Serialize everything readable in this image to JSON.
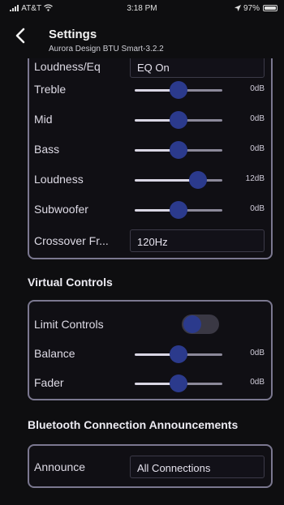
{
  "status_bar": {
    "carrier": "AT&T",
    "time": "3:18 PM",
    "battery": "97%",
    "battery_level": 0.97
  },
  "nav": {
    "title": "Settings",
    "subtitle": "Aurora Design BTU Smart-3.2.2"
  },
  "eq_section": {
    "partial_row": {
      "label": "Loudness/Eq",
      "value": "EQ On"
    },
    "sliders": [
      {
        "label": "Treble",
        "value": "0dB",
        "level": 0.5
      },
      {
        "label": "Mid",
        "value": "0dB",
        "level": 0.5
      },
      {
        "label": "Bass",
        "value": "0dB",
        "level": 0.5
      },
      {
        "label": "Loudness",
        "value": "12dB",
        "level": 0.72
      },
      {
        "label": "Subwoofer",
        "value": "0dB",
        "level": 0.5
      }
    ],
    "crossover": {
      "label": "Crossover Fr...",
      "value": "120Hz"
    }
  },
  "virtual_controls": {
    "header": "Virtual Controls",
    "limit_controls": {
      "label": "Limit Controls",
      "enabled": false
    },
    "sliders": [
      {
        "label": "Balance",
        "value": "0dB",
        "level": 0.5
      },
      {
        "label": "Fader",
        "value": "0dB",
        "level": 0.5
      }
    ]
  },
  "bluetooth": {
    "header": "Bluetooth Connection Announcements",
    "announce": {
      "label": "Announce",
      "value": "All Connections"
    }
  },
  "colors": {
    "accent_thumb": "#2b3a8c",
    "border": "#7b7890",
    "background": "#0e0e10"
  },
  "icons": {
    "back": "chevron-left-icon",
    "wifi": "wifi-icon",
    "signal": "signal-icon",
    "location": "location-arrow-icon",
    "battery": "battery-icon"
  }
}
